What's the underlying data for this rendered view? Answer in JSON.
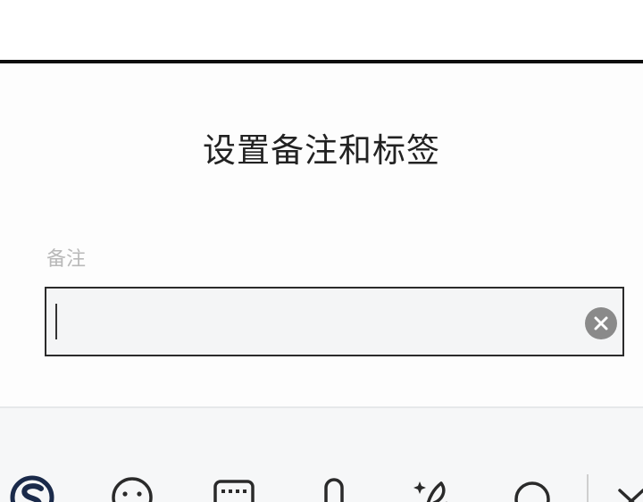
{
  "dialog": {
    "title": "设置备注和标签",
    "remark_label": "备注",
    "remark_value": ""
  },
  "keyboard": {
    "icons": [
      "sogou-logo-icon",
      "emoji-icon",
      "keyboard-grid-icon",
      "microphone-icon",
      "ai-sparkle-pen-icon",
      "search-icon",
      "collapse-keyboard-icon"
    ]
  }
}
